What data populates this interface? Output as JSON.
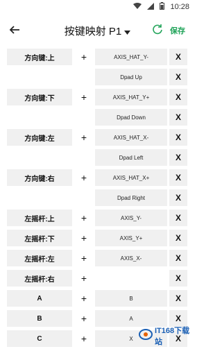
{
  "status": {
    "time": "10:28"
  },
  "header": {
    "title": "按键映射 P1",
    "save_label": "保存"
  },
  "rows": [
    {
      "key": "方向键:上",
      "map": "AXIS_HAT_Y-",
      "plus": "+",
      "del": "X"
    },
    {
      "key": "",
      "map": "Dpad Up",
      "plus": "",
      "del": "X"
    },
    {
      "key": "方向键:下",
      "map": "AXIS_HAT_Y+",
      "plus": "+",
      "del": "X"
    },
    {
      "key": "",
      "map": "Dpad Down",
      "plus": "",
      "del": "X"
    },
    {
      "key": "方向键:左",
      "map": "AXIS_HAT_X-",
      "plus": "+",
      "del": "X"
    },
    {
      "key": "",
      "map": "Dpad Left",
      "plus": "",
      "del": "X"
    },
    {
      "key": "方向键:右",
      "map": "AXIS_HAT_X+",
      "plus": "+",
      "del": "X"
    },
    {
      "key": "",
      "map": "Dpad Right",
      "plus": "",
      "del": "X"
    },
    {
      "key": "左摇杆:上",
      "map": "AXIS_Y-",
      "plus": "+",
      "del": "X"
    },
    {
      "key": "左摇杆:下",
      "map": "AXIS_Y+",
      "plus": "+",
      "del": "X"
    },
    {
      "key": "左摇杆:左",
      "map": "AXIS_X-",
      "plus": "+",
      "del": "X"
    },
    {
      "key": "左摇杆:右",
      "map": "",
      "plus": "+",
      "del": "X"
    },
    {
      "key": "A",
      "map": "B",
      "plus": "+",
      "del": "X"
    },
    {
      "key": "B",
      "map": "A",
      "plus": "+",
      "del": "X"
    },
    {
      "key": "C",
      "map": "X",
      "plus": "+",
      "del": "X"
    }
  ],
  "watermark": {
    "text": "IT168下载站"
  },
  "colors": {
    "accent": "#22a45a",
    "cell_bg": "#f0f0f0"
  }
}
